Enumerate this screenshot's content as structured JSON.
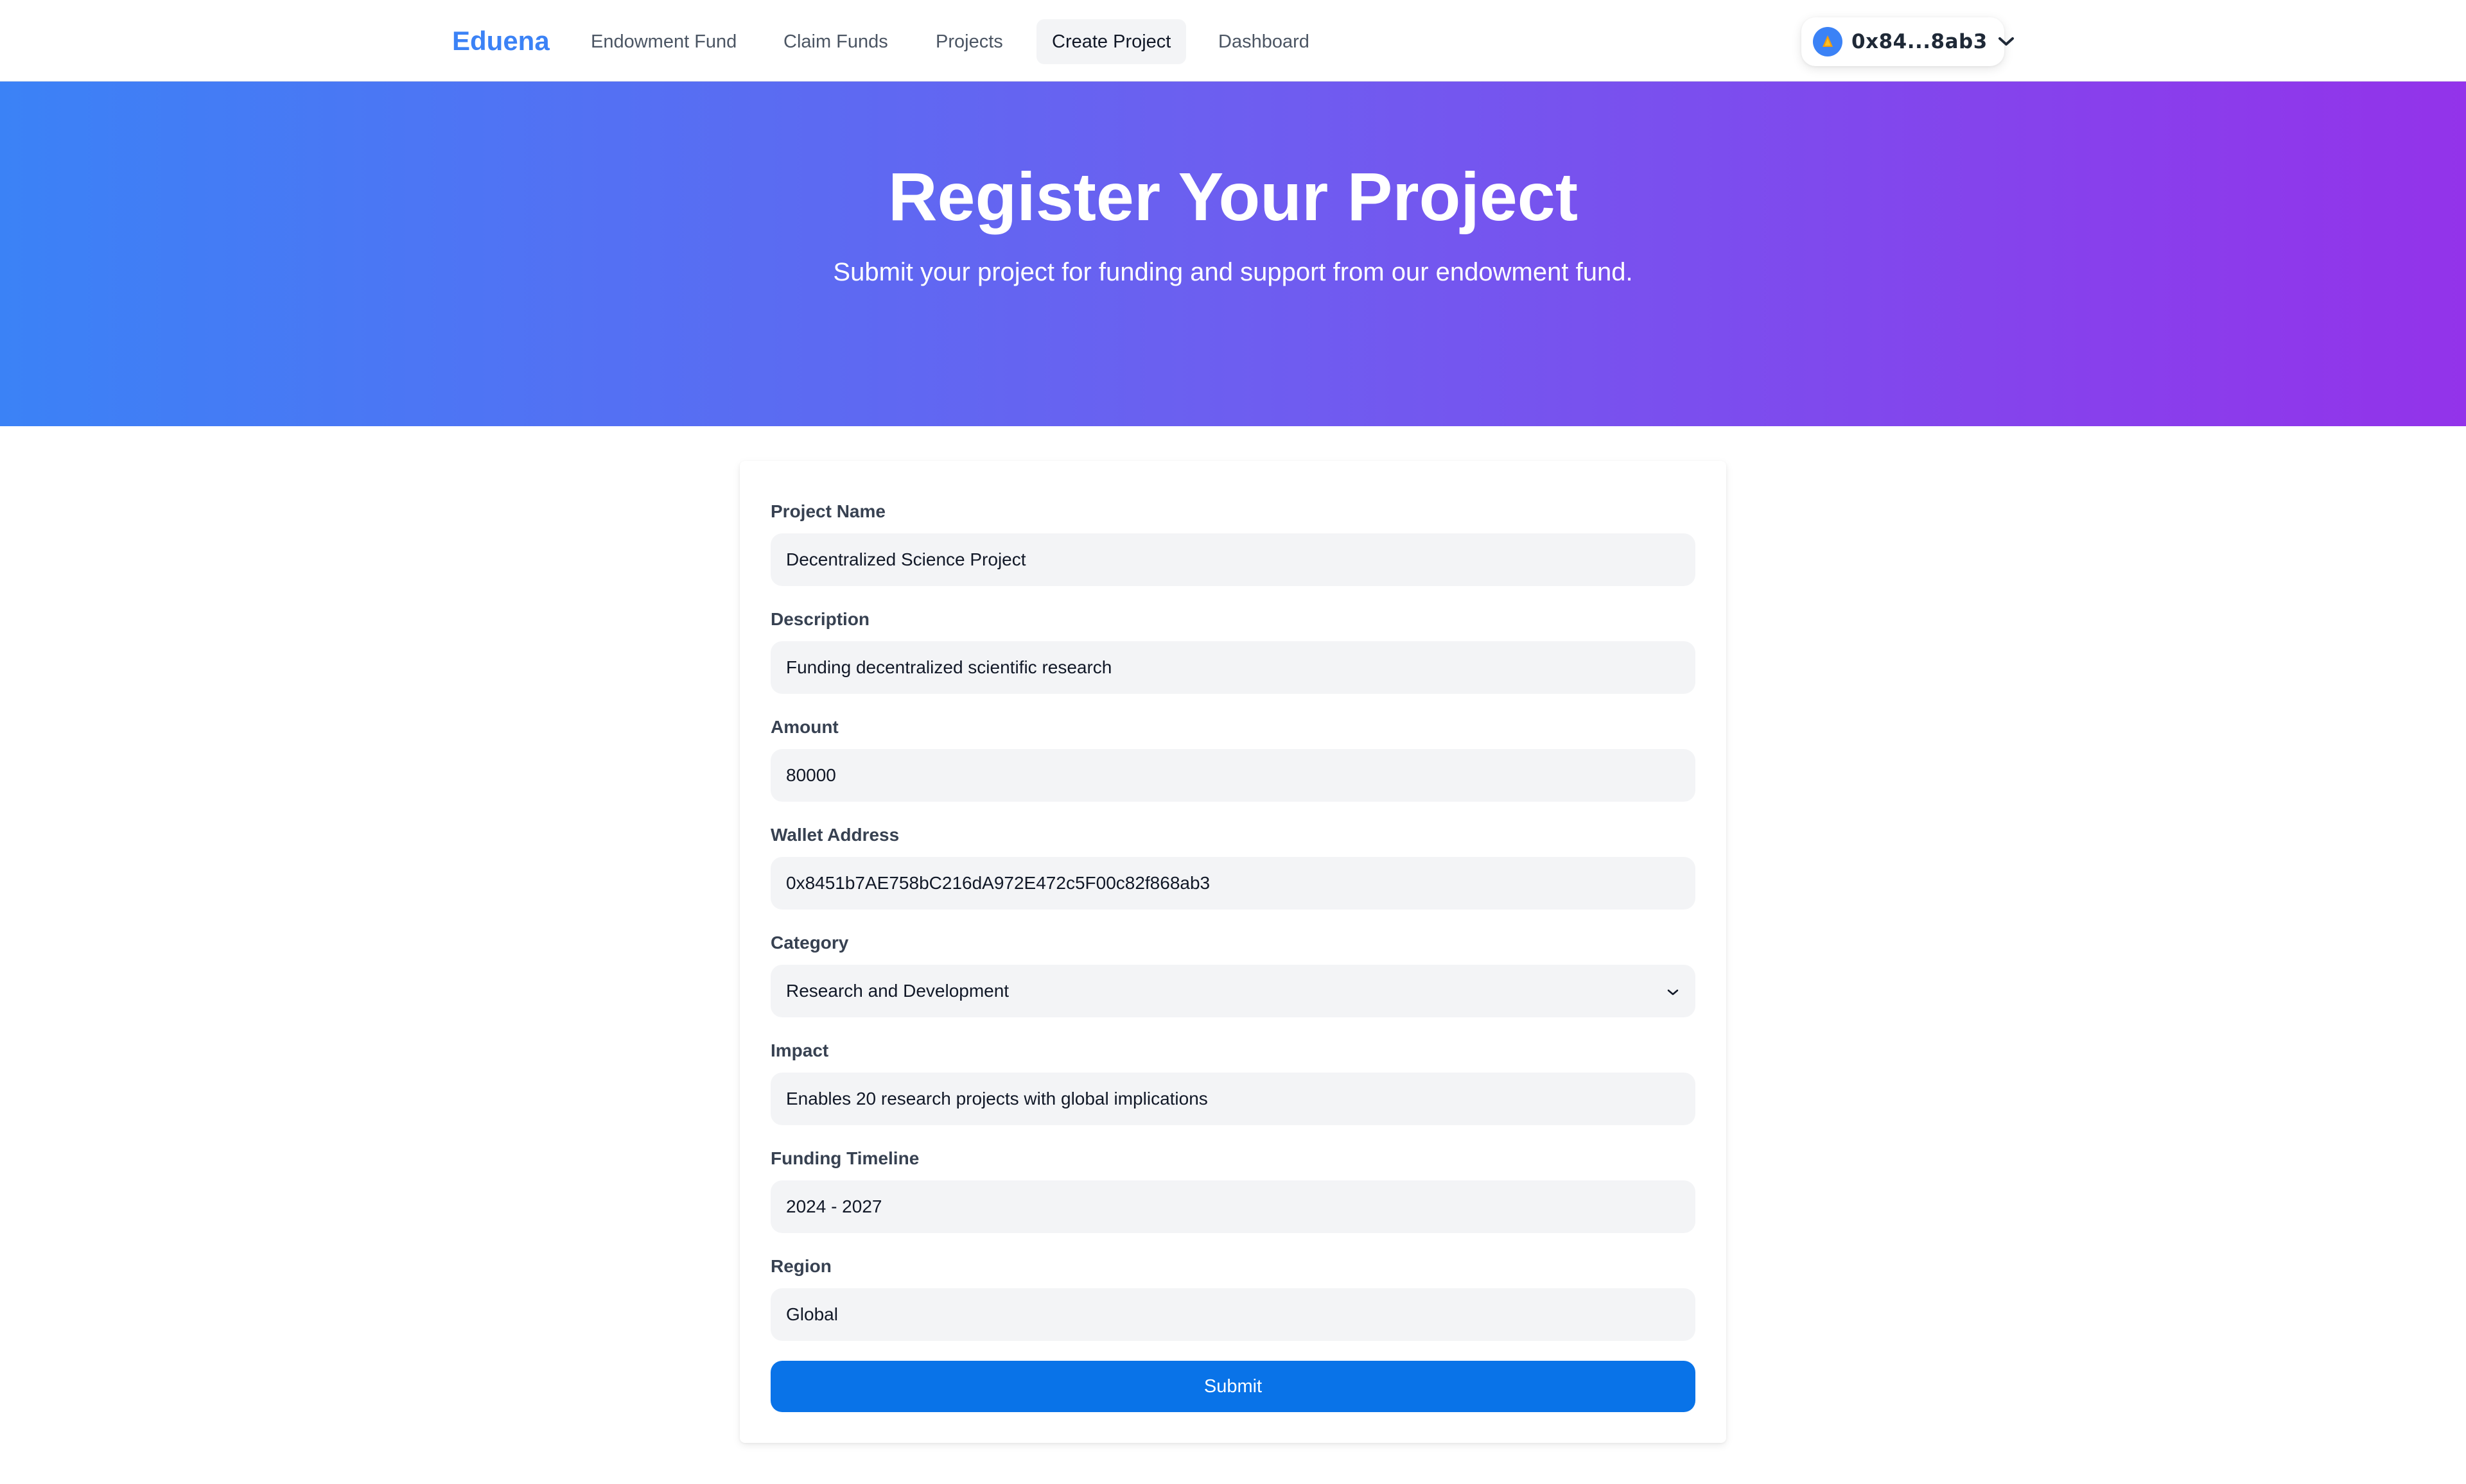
{
  "nav": {
    "brand": "Eduena",
    "links": [
      {
        "label": "Endowment Fund",
        "active": false
      },
      {
        "label": "Claim Funds",
        "active": false
      },
      {
        "label": "Projects",
        "active": false
      },
      {
        "label": "Create Project",
        "active": true
      },
      {
        "label": "Dashboard",
        "active": false
      }
    ],
    "wallet": {
      "address": "0x84...8ab3",
      "avatar_icon": "network-avatar-icon",
      "chevron_icon": "chevron-down-icon"
    }
  },
  "hero": {
    "title": "Register Your Project",
    "subtitle": "Submit your project for funding and support from our endowment fund.",
    "gradient": [
      "#3b82f6",
      "#9333ea"
    ]
  },
  "form": {
    "fields": [
      {
        "label": "Project Name",
        "value": "Decentralized Science Project",
        "type": "text"
      },
      {
        "label": "Description",
        "value": "Funding decentralized scientific research",
        "type": "text"
      },
      {
        "label": "Amount",
        "value": "80000",
        "type": "text"
      },
      {
        "label": "Wallet Address",
        "value": "0x8451b7AE758bC216dA972E472c5F00c82f868ab3",
        "type": "text"
      },
      {
        "label": "Category",
        "value": "Research and Development",
        "type": "select"
      },
      {
        "label": "Impact",
        "value": "Enables 20 research projects with global implications",
        "type": "text"
      },
      {
        "label": "Funding Timeline",
        "value": "2024 - 2027",
        "type": "text"
      },
      {
        "label": "Region",
        "value": "Global",
        "type": "text"
      }
    ],
    "submit_label": "Submit",
    "accent": "#0973e8"
  }
}
